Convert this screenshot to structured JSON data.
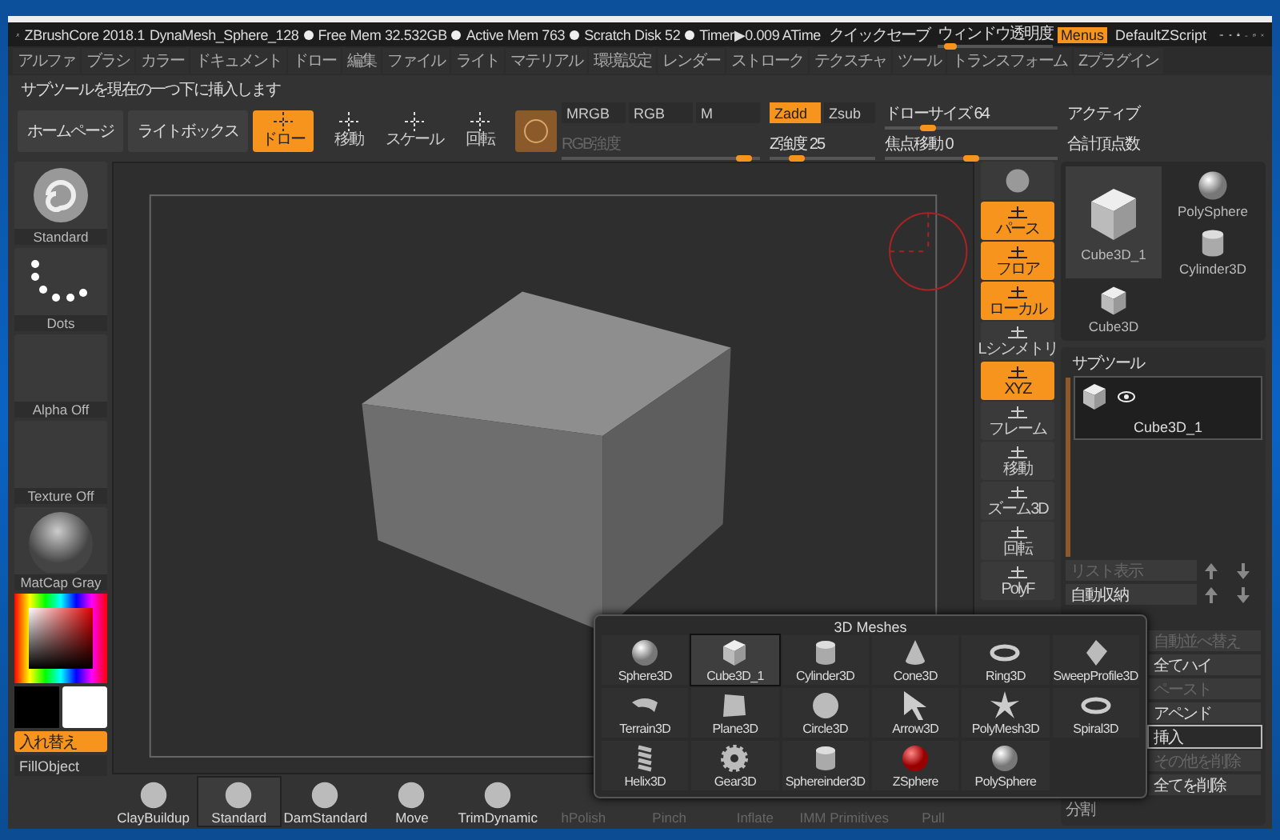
{
  "title_bar": {
    "app": "ZBrushCore 2018.1",
    "file": "DynaMesh_Sphere_128",
    "stats": [
      "Free Mem 32.532GB",
      "Active Mem 763",
      "Scratch Disk 52",
      "Timer▶0.009 ATime"
    ],
    "quicksave": "クイックセーブ",
    "transparency": {
      "label": "ウィンドウ透明度",
      "level": 0.05
    },
    "menus": {
      "label": "Menus",
      "on": true
    },
    "script": "DefaultZScript"
  },
  "menu_bar": [
    "アルファ",
    "ブラシ",
    "カラー",
    "ドキュメント",
    "ドロー",
    "編集",
    "ファイル",
    "ライト",
    "マテリアル",
    "環境設定",
    "レンダー",
    "ストローク",
    "テクスチャ",
    "ツール",
    "トランスフォーム",
    "Zプラグイン"
  ],
  "hint": "サブツールを現在の一つ下に挿入します",
  "toolbar": {
    "nav_buttons": [
      "ホームページ",
      "ライトボックス"
    ],
    "modes": [
      {
        "label": "ドロー",
        "selected": true
      },
      {
        "label": "移動",
        "selected": false
      },
      {
        "label": "スケール",
        "selected": false
      },
      {
        "label": "回転",
        "selected": false
      }
    ],
    "color_modes": [
      {
        "label": "MRGB",
        "selected": false
      },
      {
        "label": "RGB",
        "selected": false
      },
      {
        "label": "M",
        "selected": false
      }
    ],
    "depth_modes": [
      {
        "label": "Zadd",
        "selected": true
      },
      {
        "label": "Zsub",
        "selected": false
      }
    ],
    "sliders": [
      {
        "label": "RGB強度",
        "level": 0.92,
        "disabled": true
      },
      {
        "label": "Z強度 25",
        "level": 0.25,
        "disabled": false
      },
      {
        "label": "ドローサイズ 64",
        "level": 0.25,
        "disabled": false
      },
      {
        "label": "焦点移動 0",
        "level": 0.5,
        "disabled": false
      }
    ],
    "info": [
      "アクティブ",
      "合計頂点数"
    ]
  },
  "left_panel": {
    "thumbnails": [
      {
        "label": "Standard",
        "kind": "brush"
      },
      {
        "label": "Dots",
        "kind": "dots"
      },
      {
        "label": "Alpha Off",
        "kind": "empty"
      },
      {
        "label": "Texture Off",
        "kind": "empty"
      },
      {
        "label": "MatCap Gray",
        "kind": "sphere"
      }
    ],
    "swap_button": "入れ替え",
    "fill_button": "FillObject"
  },
  "view_buttons": [
    {
      "label": "パース",
      "on": true
    },
    {
      "label": "フロア",
      "on": true
    },
    {
      "label": "ローカル",
      "on": true
    },
    {
      "label": "Lシンメトリ",
      "on": false
    },
    {
      "label": "XYZ",
      "on": true
    },
    {
      "label": "フレーム",
      "on": false
    },
    {
      "label": "移動",
      "on": false
    },
    {
      "label": "ズーム3D",
      "on": false
    },
    {
      "label": "回転",
      "on": false
    },
    {
      "label": "PolyF",
      "on": false
    }
  ],
  "brushes": [
    {
      "label": "ClayBuildup",
      "selected": false,
      "disabled": false
    },
    {
      "label": "Standard",
      "selected": true,
      "disabled": false
    },
    {
      "label": "DamStandard",
      "selected": false,
      "disabled": false
    },
    {
      "label": "Move",
      "selected": false,
      "disabled": false
    },
    {
      "label": "TrimDynamic",
      "selected": false,
      "disabled": false
    },
    {
      "label": "hPolish",
      "selected": false,
      "disabled": true
    },
    {
      "label": "Pinch",
      "selected": false,
      "disabled": true
    },
    {
      "label": "Inflate",
      "selected": false,
      "disabled": true
    },
    {
      "label": "IMM Primitives",
      "selected": false,
      "disabled": true
    },
    {
      "label": "Pull",
      "selected": false,
      "disabled": true
    }
  ],
  "tool_panel": {
    "tools": [
      {
        "label": "Cube3D_1",
        "kind": "cube",
        "selected": true
      },
      {
        "label": "PolySphere",
        "kind": "sphere",
        "selected": false
      },
      {
        "label": "Cylinder3D",
        "kind": "cylinder",
        "selected": false
      },
      {
        "label": "Cube3D",
        "kind": "cube",
        "selected": false
      }
    ]
  },
  "subtool_panel": {
    "title": "サブツール",
    "items": [
      {
        "label": "Cube3D_1",
        "selected": true
      }
    ],
    "list_buttons": [
      {
        "label": "リスト表示",
        "disabled": true
      },
      {
        "label": "自動収納",
        "disabled": false
      }
    ],
    "buttons": [
      {
        "label": "自動並べ替え",
        "disabled": true,
        "selected": false
      },
      {
        "label": "全てハイ",
        "disabled": false,
        "selected": false
      },
      {
        "label": "ペースト",
        "disabled": true,
        "selected": false
      },
      {
        "label": "アペンド",
        "disabled": false,
        "selected": false
      },
      {
        "label": "挿入",
        "disabled": false,
        "selected": true
      },
      {
        "label": "その他を削除",
        "disabled": true,
        "selected": false
      },
      {
        "label": "全てを削除",
        "disabled": false,
        "selected": false
      }
    ],
    "split_label": "分割"
  },
  "mesh_popup": {
    "title": "3D Meshes",
    "items": [
      {
        "label": "Sphere3D",
        "kind": "sphere",
        "selected": false
      },
      {
        "label": "Cube3D_1",
        "kind": "cube",
        "selected": true
      },
      {
        "label": "Cylinder3D",
        "kind": "cylinder",
        "selected": false
      },
      {
        "label": "Cone3D",
        "kind": "cone",
        "selected": false
      },
      {
        "label": "Ring3D",
        "kind": "ring",
        "selected": false
      },
      {
        "label": "SweepProfile3D",
        "kind": "diamond",
        "selected": false
      },
      {
        "label": "Terrain3D",
        "kind": "sheet",
        "selected": false
      },
      {
        "label": "Plane3D",
        "kind": "plane",
        "selected": false
      },
      {
        "label": "Circle3D",
        "kind": "disc",
        "selected": false
      },
      {
        "label": "Arrow3D",
        "kind": "arrow",
        "selected": false
      },
      {
        "label": "PolyMesh3D",
        "kind": "star",
        "selected": false
      },
      {
        "label": "Spiral3D",
        "kind": "ring",
        "selected": false
      },
      {
        "label": "Helix3D",
        "kind": "helix",
        "selected": false
      },
      {
        "label": "Gear3D",
        "kind": "gear",
        "selected": false
      },
      {
        "label": "Sphereinder3D",
        "kind": "cylinder",
        "selected": false
      },
      {
        "label": "ZSphere",
        "kind": "zsphere",
        "selected": false
      },
      {
        "label": "PolySphere",
        "kind": "sphere",
        "selected": false
      }
    ]
  }
}
